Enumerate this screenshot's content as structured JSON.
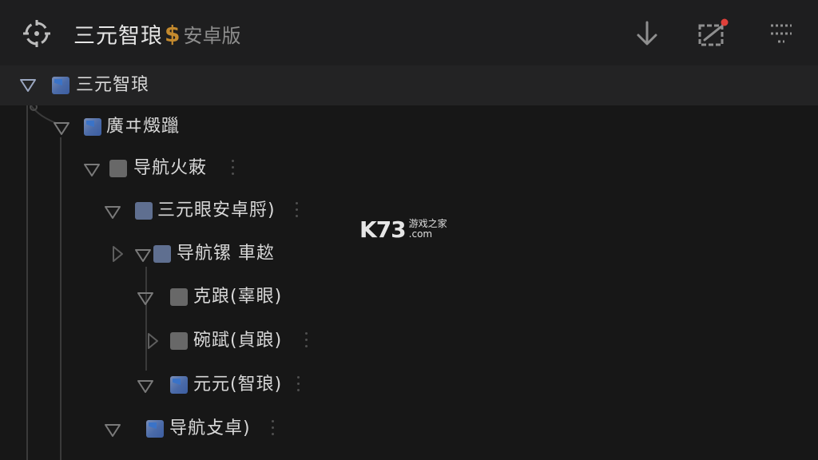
{
  "header": {
    "app_name": "三元智琅",
    "currency_symbol": "$",
    "edition": "安卓版",
    "logo_icon": "crosshair-gear-icon",
    "actions": [
      {
        "name": "download",
        "icon": "download-arrow-icon"
      },
      {
        "name": "edit",
        "icon": "edit-note-icon",
        "badge": true
      },
      {
        "name": "menu",
        "icon": "menu-dots-icon"
      }
    ]
  },
  "tree": {
    "nodes": [
      {
        "label": "三元智琅",
        "box": "flag",
        "expanded": true,
        "selected": true,
        "has_menu": false
      },
      {
        "label": "廣ヰ燬躐",
        "box": "flag",
        "expanded": true,
        "has_menu": false
      },
      {
        "label": "导航火蓛",
        "box": "gray",
        "expanded": true,
        "has_menu": true
      },
      {
        "label": "三元眼安卓脟)",
        "box": "blue",
        "expanded": true,
        "has_menu": true
      },
      {
        "label": "导航镙 車趑",
        "box": "blue",
        "expanded": true,
        "has_menu": false
      },
      {
        "label": "克踉(辜眼)",
        "box": "gray",
        "expanded": true,
        "has_menu": false
      },
      {
        "label": "碗䟼(貞踉)",
        "box": "gray",
        "expanded": false,
        "has_menu": true
      },
      {
        "label": "元元(智琅)",
        "box": "flag",
        "expanded": true,
        "has_menu": true
      },
      {
        "label": "导航攴卓)",
        "box": "flag",
        "expanded": true,
        "has_menu": true
      }
    ]
  },
  "watermark": {
    "brand": "K73",
    "tagline": "游戏之家",
    "domain": ".com"
  },
  "colors": {
    "background": "#171717",
    "header": "#1e1e1f",
    "accent_gold": "#c48a2e",
    "badge_red": "#e0403a",
    "tree_line": "#3a3a3a"
  }
}
